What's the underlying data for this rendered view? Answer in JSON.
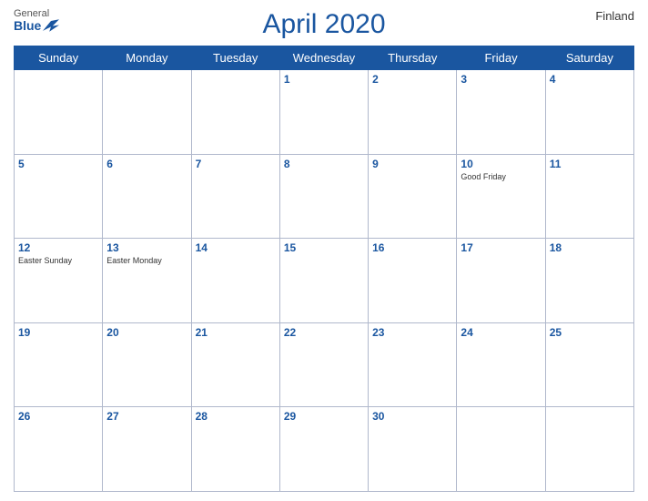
{
  "header": {
    "logo": {
      "general": "General",
      "blue": "Blue"
    },
    "title": "April 2020",
    "country": "Finland"
  },
  "weekdays": [
    "Sunday",
    "Monday",
    "Tuesday",
    "Wednesday",
    "Thursday",
    "Friday",
    "Saturday"
  ],
  "weeks": [
    [
      {
        "day": null,
        "holiday": null
      },
      {
        "day": null,
        "holiday": null
      },
      {
        "day": null,
        "holiday": null
      },
      {
        "day": 1,
        "holiday": null
      },
      {
        "day": 2,
        "holiday": null
      },
      {
        "day": 3,
        "holiday": null
      },
      {
        "day": 4,
        "holiday": null
      }
    ],
    [
      {
        "day": 5,
        "holiday": null
      },
      {
        "day": 6,
        "holiday": null
      },
      {
        "day": 7,
        "holiday": null
      },
      {
        "day": 8,
        "holiday": null
      },
      {
        "day": 9,
        "holiday": null
      },
      {
        "day": 10,
        "holiday": "Good Friday"
      },
      {
        "day": 11,
        "holiday": null
      }
    ],
    [
      {
        "day": 12,
        "holiday": "Easter Sunday"
      },
      {
        "day": 13,
        "holiday": "Easter Monday"
      },
      {
        "day": 14,
        "holiday": null
      },
      {
        "day": 15,
        "holiday": null
      },
      {
        "day": 16,
        "holiday": null
      },
      {
        "day": 17,
        "holiday": null
      },
      {
        "day": 18,
        "holiday": null
      }
    ],
    [
      {
        "day": 19,
        "holiday": null
      },
      {
        "day": 20,
        "holiday": null
      },
      {
        "day": 21,
        "holiday": null
      },
      {
        "day": 22,
        "holiday": null
      },
      {
        "day": 23,
        "holiday": null
      },
      {
        "day": 24,
        "holiday": null
      },
      {
        "day": 25,
        "holiday": null
      }
    ],
    [
      {
        "day": 26,
        "holiday": null
      },
      {
        "day": 27,
        "holiday": null
      },
      {
        "day": 28,
        "holiday": null
      },
      {
        "day": 29,
        "holiday": null
      },
      {
        "day": 30,
        "holiday": null
      },
      {
        "day": null,
        "holiday": null
      },
      {
        "day": null,
        "holiday": null
      }
    ]
  ]
}
